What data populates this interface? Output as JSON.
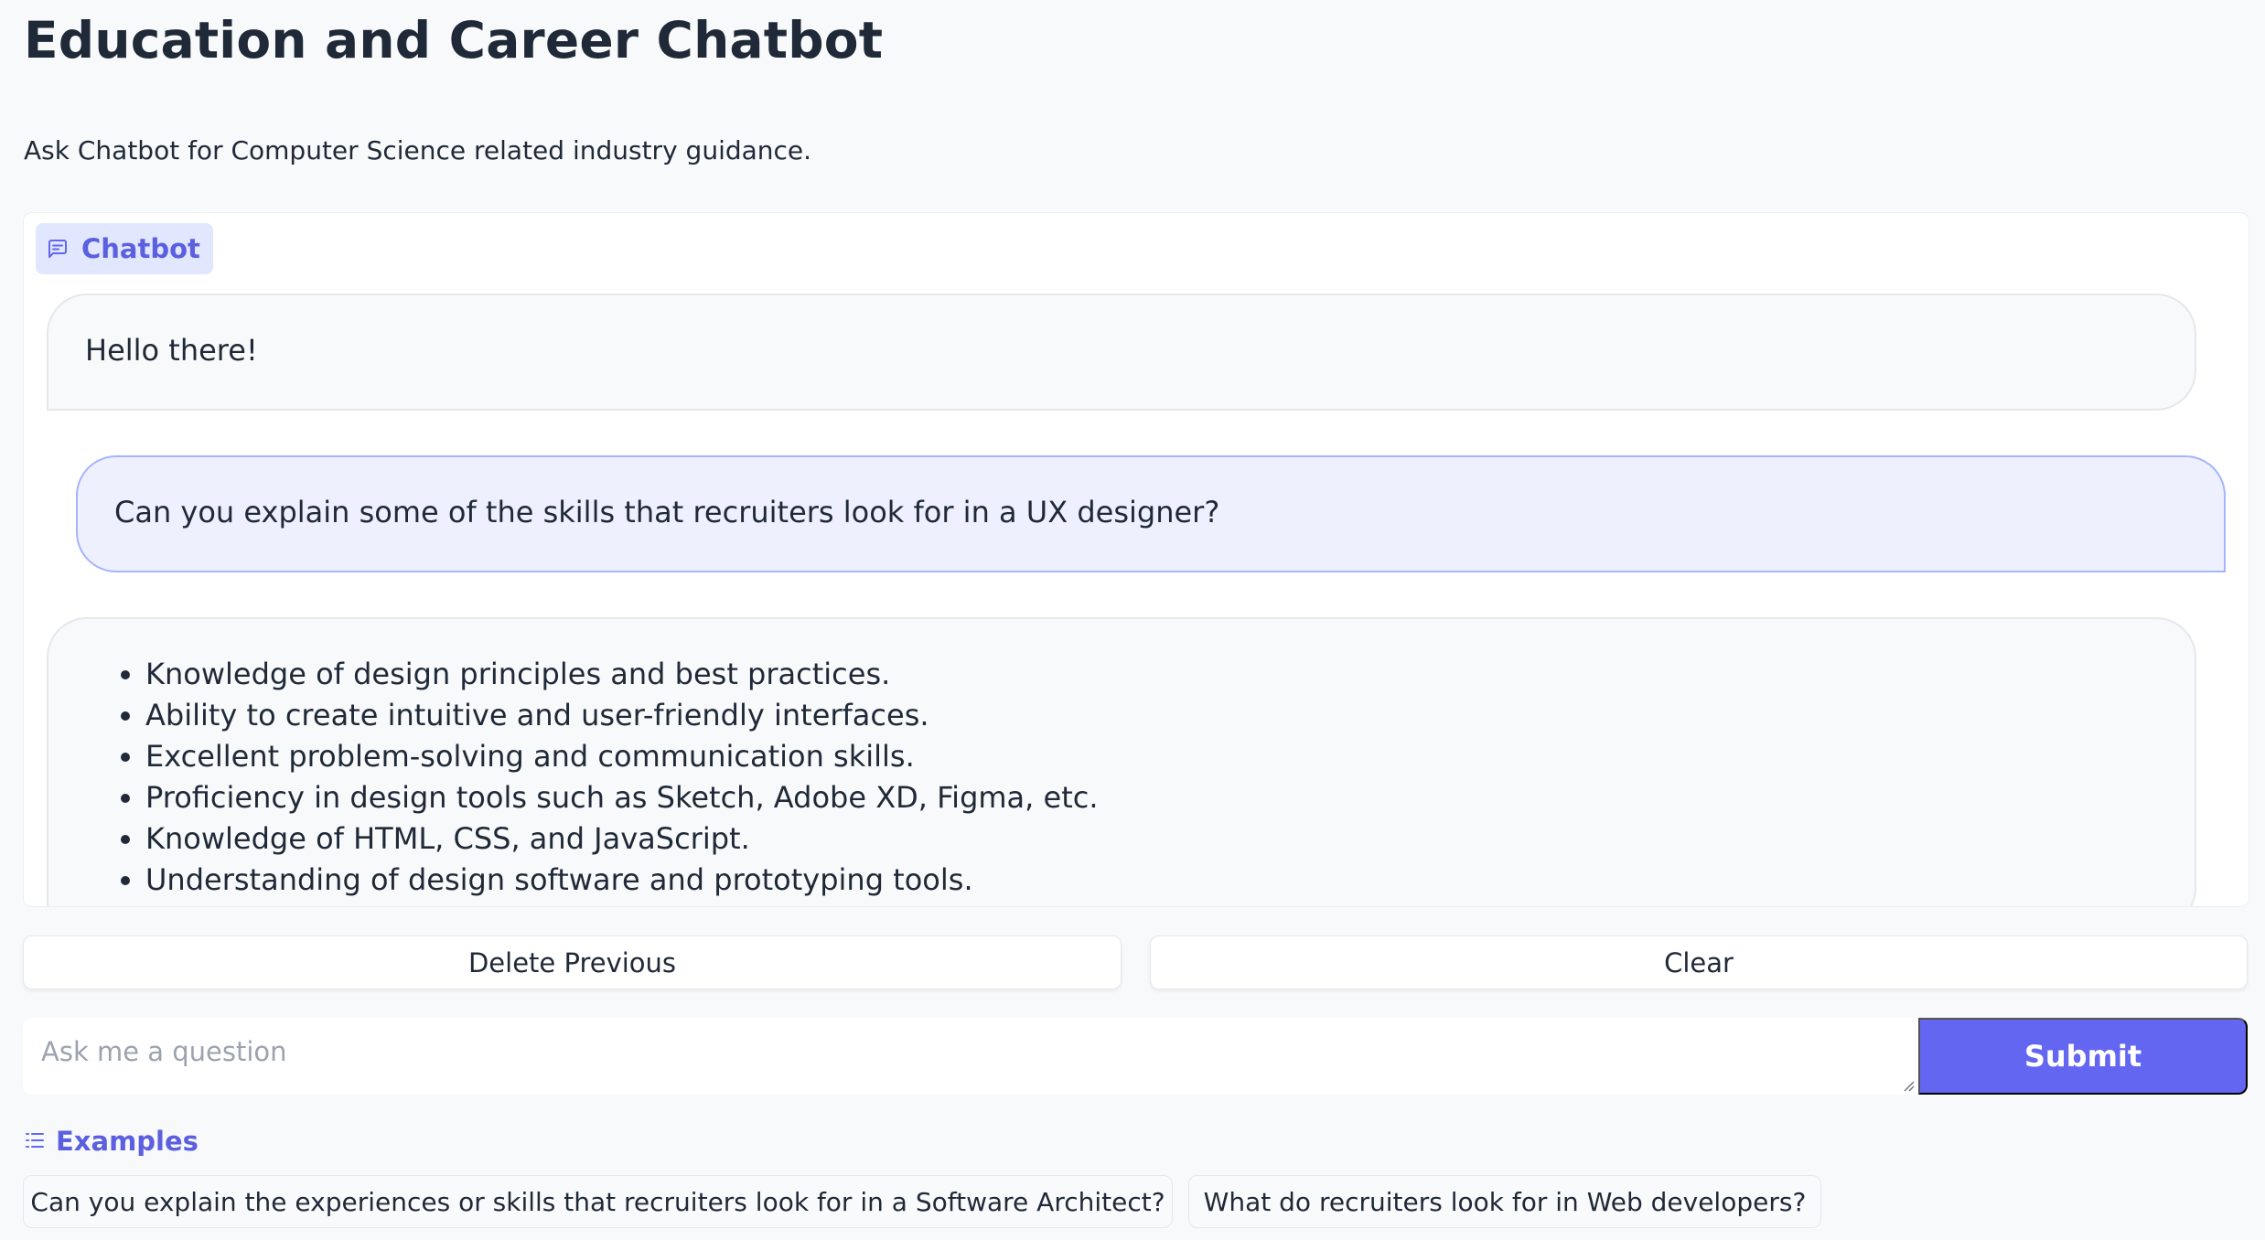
{
  "app": {
    "title": "Education and Career Chatbot",
    "description": "Ask Chatbot for Computer Science related industry guidance."
  },
  "chatbot": {
    "label": "Chatbot",
    "icon": "chat-icon",
    "messages": [
      {
        "role": "bot",
        "text": "Hello there!"
      },
      {
        "role": "user",
        "text": "Can you explain some of the skills that recruiters look for in a UX designer?"
      },
      {
        "role": "bot",
        "items": [
          "Knowledge of design principles and best practices.",
          "Ability to create intuitive and user-friendly interfaces.",
          "Excellent problem-solving and communication skills.",
          "Proficiency in design tools such as Sketch, Adobe XD, Figma, etc.",
          "Knowledge of HTML, CSS, and JavaScript.",
          "Understanding of design software and prototyping tools."
        ]
      }
    ]
  },
  "actions": {
    "delete_previous": "Delete Previous",
    "clear": "Clear"
  },
  "input": {
    "placeholder": "Ask me a question",
    "value": "",
    "submit_label": "Submit"
  },
  "examples": {
    "label": "Examples",
    "icon": "list-icon",
    "items": [
      "Can you explain the experiences or skills that recruiters look for in a Software Architect?",
      "What do recruiters look for in Web developers?"
    ]
  },
  "colors": {
    "accent": "#6366f1",
    "accent_text": "#5b5fe0",
    "badge_bg": "#e0e7ff",
    "user_bubble_bg": "#eef0fe",
    "user_bubble_border": "#a5b4fc",
    "page_bg": "#f8f9fb"
  }
}
